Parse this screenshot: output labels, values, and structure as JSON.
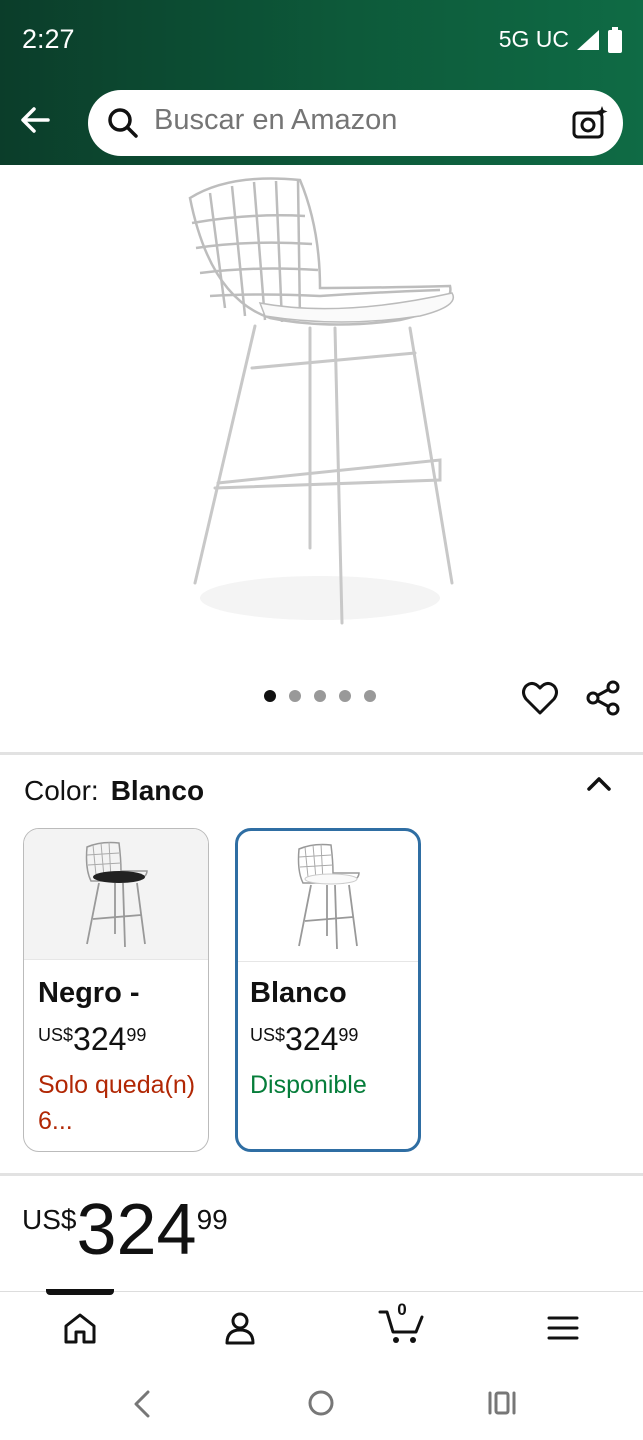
{
  "status_bar": {
    "time": "2:27",
    "network": "5G UC"
  },
  "search": {
    "placeholder": "Buscar en Amazon"
  },
  "product": {
    "image_icon": "wire-bar-stool-image",
    "image_count": 5,
    "active_image": 1
  },
  "color_section": {
    "label": "Color:",
    "value": "Blanco"
  },
  "variants": [
    {
      "title": "Negro -",
      "currency": "US$",
      "whole": "324",
      "cents": "99",
      "status": "Solo queda(n) 6...",
      "status_color": "#b12704",
      "selected": false
    },
    {
      "title": "Blanco",
      "currency": "US$",
      "whole": "324",
      "cents": "99",
      "status": "Disponible",
      "status_color": "#067d3a",
      "selected": true
    }
  ],
  "price": {
    "currency": "US$",
    "whole": "324",
    "cents": "99"
  },
  "bottom_nav": {
    "items": [
      "home-icon",
      "account-icon",
      "cart-icon",
      "menu-icon"
    ],
    "cart_count": "0"
  },
  "colors": {
    "header_start": "#0b3d2a",
    "header_end": "#0f6b45",
    "selected_border": "#2f6ea3"
  }
}
